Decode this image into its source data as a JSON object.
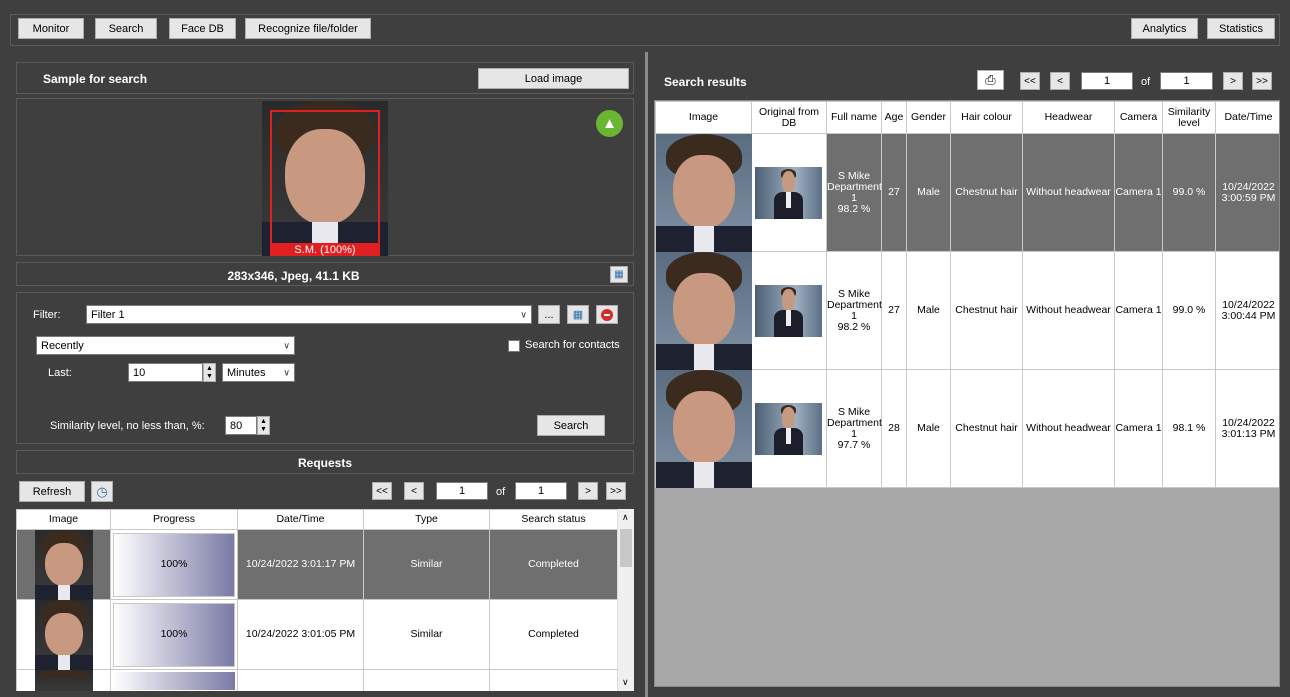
{
  "toolbar": {
    "monitor": "Monitor",
    "search": "Search",
    "face_db": "Face DB",
    "recognize": "Recognize file/folder",
    "analytics": "Analytics",
    "statistics": "Statistics"
  },
  "sample": {
    "title": "Sample for search",
    "load_image": "Load image",
    "face_label": "S.M. (100%)",
    "image_info": "283x346, Jpeg, 41.1 KB"
  },
  "filter": {
    "label": "Filter:",
    "value": "Filter 1",
    "more_label": "...",
    "period_value": "Recently",
    "search_contacts": "Search for contacts",
    "last_label": "Last:",
    "last_value": "10",
    "unit_value": "Minutes",
    "similarity_label": "Similarity level, no less than, %:",
    "similarity_value": "80",
    "search_button": "Search"
  },
  "requests": {
    "title": "Requests",
    "refresh": "Refresh",
    "page_current": "1",
    "of_label": "of",
    "page_total": "1",
    "first": "<<",
    "prev": "<",
    "next": ">",
    "last": ">>",
    "columns": [
      "Image",
      "Progress",
      "Date/Time",
      "Type",
      "Search status"
    ],
    "rows": [
      {
        "progress": "100%",
        "progress_value": 1.0,
        "datetime": "10/24/2022 3:01:17 PM",
        "type": "Similar",
        "status": "Completed"
      },
      {
        "progress": "100%",
        "progress_value": 1.0,
        "datetime": "10/24/2022 3:01:05 PM",
        "type": "Similar",
        "status": "Completed"
      }
    ]
  },
  "results": {
    "title": "Search results",
    "page_current": "1",
    "of_label": "of",
    "page_total": "1",
    "first": "<<",
    "prev": "<",
    "next": ">",
    "last": ">>",
    "columns": [
      "Image",
      "Original from DB",
      "Full name",
      "Age",
      "Gender",
      "Hair colour",
      "Headwear",
      "Camera",
      "Similarity level",
      "Date/Time"
    ],
    "rows": [
      {
        "name1": "S Mike",
        "name2": "Department",
        "name3": "1",
        "name4": "98.2 %",
        "age": "27",
        "gender": "Male",
        "hair": "Chestnut hair",
        "headwear": "Without headwear",
        "camera": "Camera 1",
        "similarity": "99.0 %",
        "date": "10/24/2022",
        "time": "3:00:59 PM"
      },
      {
        "name1": "S Mike",
        "name2": "Department",
        "name3": "1",
        "name4": "98.2 %",
        "age": "27",
        "gender": "Male",
        "hair": "Chestnut hair",
        "headwear": "Without headwear",
        "camera": "Camera 1",
        "similarity": "99.0 %",
        "date": "10/24/2022",
        "time": "3:00:44 PM"
      },
      {
        "name1": "S Mike",
        "name2": "Department",
        "name3": "1",
        "name4": "97.7 %",
        "age": "28",
        "gender": "Male",
        "hair": "Chestnut hair",
        "headwear": "Without headwear",
        "camera": "Camera 1",
        "similarity": "98.1 %",
        "date": "10/24/2022",
        "time": "3:01:13 PM"
      }
    ]
  },
  "colors": {
    "background": "#3f3f3f",
    "selected_row": "#6f6f6f",
    "thumbs_up": "#6cb533",
    "face_frame": "#e02020"
  }
}
